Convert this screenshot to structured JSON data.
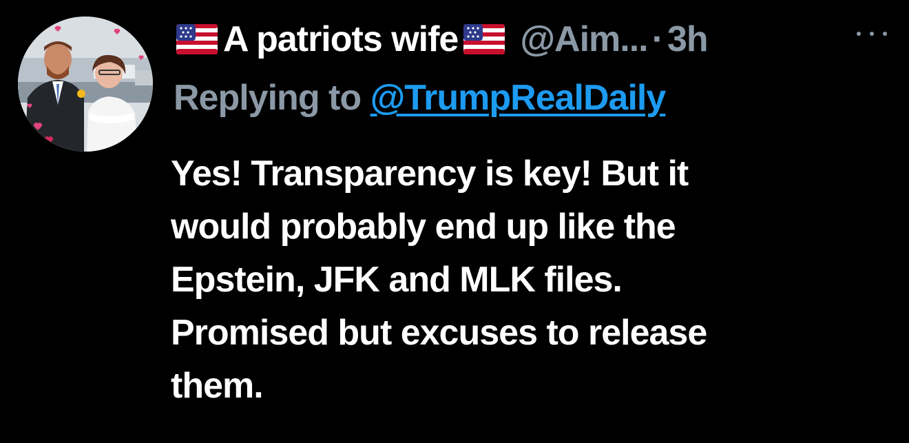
{
  "author": {
    "flag_left": "🇺🇸",
    "display_name": "A patriots wife",
    "flag_right": "🇺🇸",
    "handle": "@Aim...",
    "separator": "·",
    "timestamp": "3h"
  },
  "reply": {
    "prefix": "Replying to",
    "mention": "@TrumpRealDaily"
  },
  "tweet_text": {
    "lines": [
      "Yes! Transparency is key! But it",
      "would probably end up like the",
      "Epstein, JFK and MLK files.",
      "Promised but excuses to release",
      "them."
    ]
  },
  "icons": {
    "more": "more-horizontal-icon",
    "flag": "us-flag-icon",
    "avatar": "profile-photo"
  },
  "colors": {
    "background": "#000000",
    "primary_text": "#ffffff",
    "secondary_text": "#8b98a5",
    "link": "#1d9bf0"
  }
}
